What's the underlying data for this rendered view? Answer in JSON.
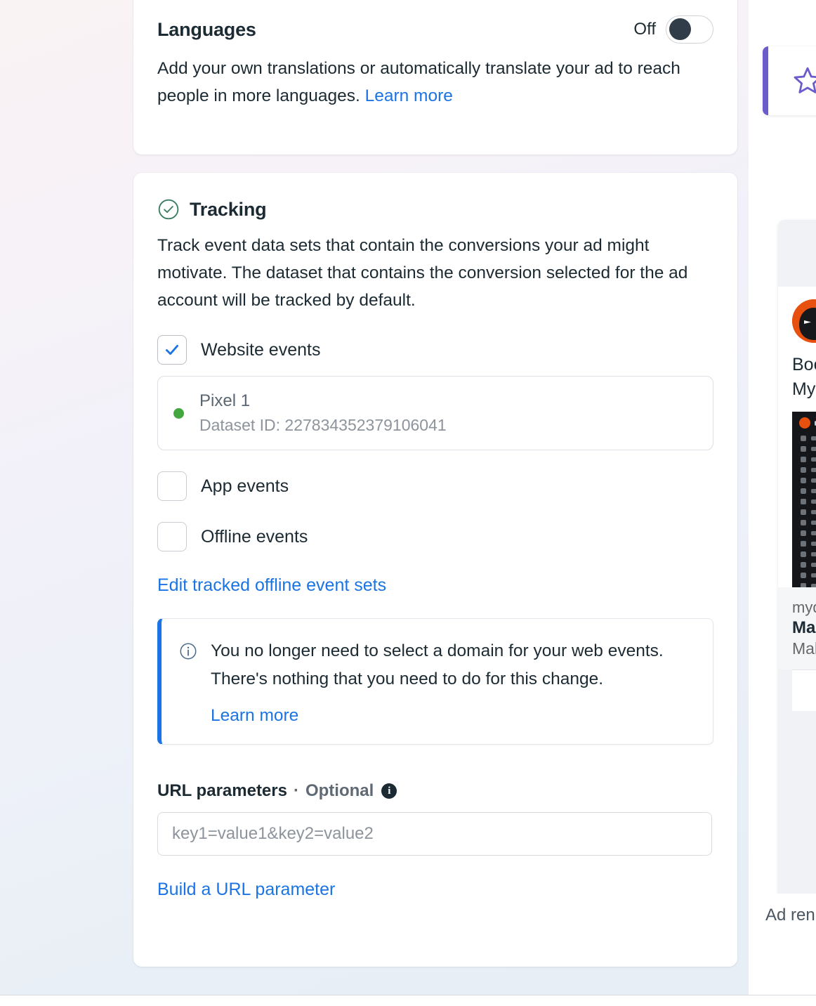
{
  "languages": {
    "title": "Languages",
    "toggle_state_label": "Off",
    "description": "Add your own translations or automatically translate your ad to reach people in more languages.",
    "learn_more": "Learn more"
  },
  "tracking": {
    "title": "Tracking",
    "status_icon": "check-circle-icon",
    "description": "Track event data sets that contain the conversions your ad might motivate. The dataset that contains the conversion selected for the ad account will be tracked by default.",
    "options": [
      {
        "label": "Website events",
        "checked": true
      },
      {
        "label": "App events",
        "checked": false
      },
      {
        "label": "Offline events",
        "checked": false
      }
    ],
    "pixel": {
      "name": "Pixel 1",
      "dataset_id_label": "Dataset ID: 227834352379106041",
      "status": "active",
      "status_color": "#42a73f"
    },
    "edit_offline_link": "Edit tracked offline event sets",
    "callout": {
      "icon": "info-circle-icon",
      "text": "You no longer need to select a domain for your web events. There's nothing that you need to do for this change.",
      "link": "Learn more"
    },
    "url_parameters": {
      "label": "URL parameters",
      "separator": "·",
      "optional": "Optional",
      "info_glyph": "i",
      "value": "",
      "placeholder": "key1=value1&key2=value2",
      "build_link": "Build a URL parameter"
    }
  },
  "preview_rail": {
    "star_card_icon": "star-outline-icon",
    "ad": {
      "headline_line1": "Boos",
      "headline_line2": "MyD",
      "domain": "myda",
      "title": "Max",
      "subtitle": "Mak",
      "like_icon": "thumbs-up-icon"
    },
    "footer_label": "Ad ren"
  },
  "colors": {
    "link": "#1b74e4",
    "accent_purple": "#6b5ccc",
    "success_green": "#42a73f",
    "text_primary": "#1c2b33",
    "text_muted": "#65676b"
  }
}
